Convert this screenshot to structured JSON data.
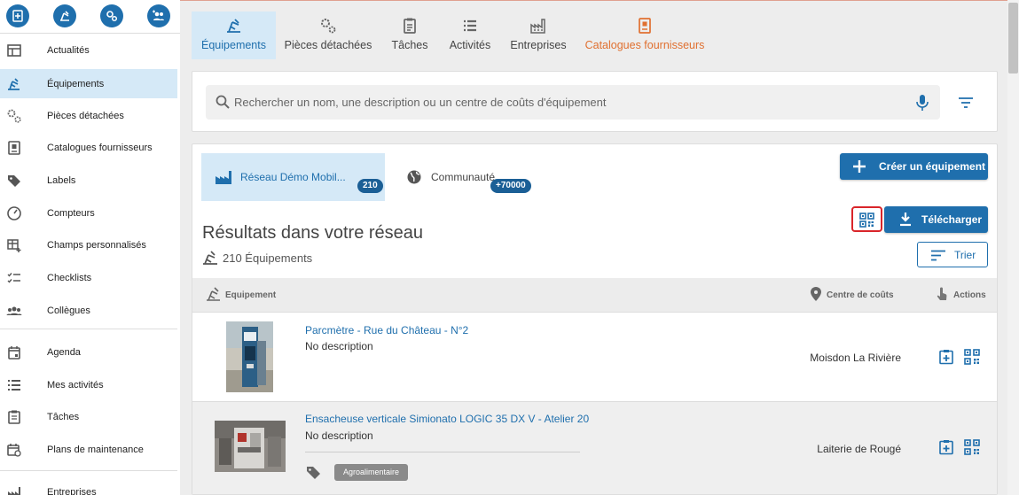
{
  "sidebar": {
    "quick_actions": [
      "add-item-icon",
      "equipment-icon",
      "parts-icon",
      "add-group-icon"
    ],
    "items": [
      {
        "label": "Actualités",
        "icon": "news-icon"
      },
      {
        "label": "Équipements",
        "icon": "equipment-icon",
        "active": true
      },
      {
        "label": "Pièces détachées",
        "icon": "parts-icon"
      },
      {
        "label": "Catalogues fournisseurs",
        "icon": "catalog-icon"
      },
      {
        "label": "Labels",
        "icon": "label-icon"
      },
      {
        "label": "Compteurs",
        "icon": "gauge-icon"
      },
      {
        "label": "Champs personnalisés",
        "icon": "custom-fields-icon"
      },
      {
        "label": "Checklists",
        "icon": "checklist-icon"
      },
      {
        "label": "Collègues",
        "icon": "people-icon"
      },
      {
        "label": "Agenda",
        "icon": "calendar-icon"
      },
      {
        "label": "Mes activités",
        "icon": "list-icon"
      },
      {
        "label": "Tâches",
        "icon": "task-icon"
      },
      {
        "label": "Plans de maintenance",
        "icon": "maintenance-plan-icon"
      },
      {
        "label": "Entreprises",
        "icon": "factory-icon"
      }
    ]
  },
  "tabs": [
    {
      "label": "Équipements",
      "icon": "equipment-icon",
      "active": true
    },
    {
      "label": "Pièces détachées",
      "icon": "parts-icon"
    },
    {
      "label": "Tâches",
      "icon": "task-icon"
    },
    {
      "label": "Activités",
      "icon": "list-icon"
    },
    {
      "label": "Entreprises",
      "icon": "factory-icon"
    },
    {
      "label": "Catalogues fournisseurs",
      "icon": "catalog-icon",
      "highlight": "orange"
    }
  ],
  "search": {
    "placeholder": "Rechercher un nom, une description ou un centre de coûts d'équipement",
    "value": ""
  },
  "scopes": {
    "network": {
      "label": "Réseau Démo Mobil...",
      "count": "210"
    },
    "community": {
      "label": "Communauté",
      "count": "+70000"
    }
  },
  "buttons": {
    "create": "Créer un équipement",
    "download": "Télécharger",
    "sort": "Trier"
  },
  "results": {
    "title": "Résultats dans votre réseau",
    "count": "210 Équipements"
  },
  "table": {
    "headers": {
      "equipment": "Equipement",
      "cost_center": "Centre de coûts",
      "actions": "Actions"
    },
    "rows": [
      {
        "name": "Parcmètre - Rue du Château - N°2",
        "description": "No description",
        "cost_center": "Moisdon La Rivière"
      },
      {
        "name": "Ensacheuse verticale Simionato LOGIC 35 DX V - Atelier 20",
        "description": "No description",
        "cost_center": "Laiterie de Rougé",
        "tag": "Agroalimentaire"
      }
    ]
  },
  "colors": {
    "accent": "#1f6fad",
    "active_bg": "#d5e9f7",
    "highlight": "#e07030",
    "qr_outline": "#d9252a"
  }
}
